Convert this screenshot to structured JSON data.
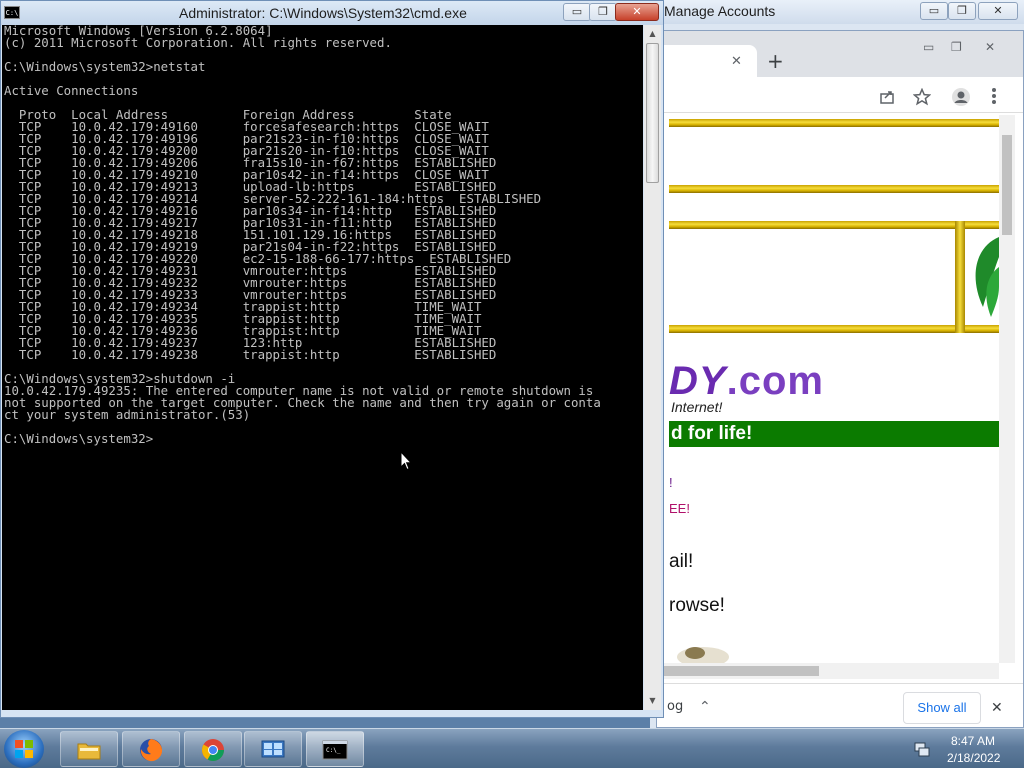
{
  "background_window": {
    "title": "Manage Accounts",
    "minimize": "▭",
    "maximize": "❐",
    "close": "✕"
  },
  "chrome": {
    "tab_close": "✕",
    "new_tab": "+",
    "minimize": "▭",
    "maximize": "❐",
    "close": "✕",
    "page": {
      "logo_main": "DY",
      "logo_dotcom": ".com",
      "tagline": "Internet!",
      "banner": "d for life!",
      "link1": "!",
      "link2": "EE!",
      "line1": "ail!",
      "line2": "rowse!"
    },
    "download_bar": {
      "item": "og",
      "chevron": "⌃",
      "show_all": "Show all",
      "close": "✕"
    }
  },
  "cmd": {
    "title": "Administrator: C:\\Windows\\System32\\cmd.exe",
    "icon_label": "C:\\",
    "minimize": "▭",
    "maximize": "❐",
    "close": "✕",
    "lines": [
      "Microsoft Windows [Version 6.2.8064]",
      "(c) 2011 Microsoft Corporation. All rights reserved.",
      "",
      "C:\\Windows\\system32>netstat",
      "",
      "Active Connections",
      "",
      "  Proto  Local Address          Foreign Address        State",
      "  TCP    10.0.42.179:49160      forcesafesearch:https  CLOSE_WAIT",
      "  TCP    10.0.42.179:49196      par21s23-in-f10:https  CLOSE_WAIT",
      "  TCP    10.0.42.179:49200      par21s20-in-f10:https  CLOSE_WAIT",
      "  TCP    10.0.42.179:49206      fra15s10-in-f67:https  ESTABLISHED",
      "  TCP    10.0.42.179:49210      par10s42-in-f14:https  CLOSE_WAIT",
      "  TCP    10.0.42.179:49213      upload-lb:https        ESTABLISHED",
      "  TCP    10.0.42.179:49214      server-52-222-161-184:https  ESTABLISHED",
      "  TCP    10.0.42.179:49216      par10s34-in-f14:http   ESTABLISHED",
      "  TCP    10.0.42.179:49217      par10s31-in-f11:http   ESTABLISHED",
      "  TCP    10.0.42.179:49218      151.101.129.16:https   ESTABLISHED",
      "  TCP    10.0.42.179:49219      par21s04-in-f22:https  ESTABLISHED",
      "  TCP    10.0.42.179:49220      ec2-15-188-66-177:https  ESTABLISHED",
      "  TCP    10.0.42.179:49231      vmrouter:https         ESTABLISHED",
      "  TCP    10.0.42.179:49232      vmrouter:https         ESTABLISHED",
      "  TCP    10.0.42.179:49233      vmrouter:https         ESTABLISHED",
      "  TCP    10.0.42.179:49234      trappist:http          TIME_WAIT",
      "  TCP    10.0.42.179:49235      trappist:http          TIME_WAIT",
      "  TCP    10.0.42.179:49236      trappist:http          TIME_WAIT",
      "  TCP    10.0.42.179:49237      123:http               ESTABLISHED",
      "  TCP    10.0.42.179:49238      trappist:http          ESTABLISHED",
      "",
      "C:\\Windows\\system32>shutdown -i",
      "10.0.42.179.49235: The entered computer name is not valid or remote shutdown is",
      "not supported on the target computer. Check the name and then try again or conta",
      "ct your system administrator.(53)",
      "",
      "C:\\Windows\\system32>"
    ]
  },
  "taskbar": {
    "items": [
      {
        "name": "file-explorer",
        "icon": "folder-icon"
      },
      {
        "name": "firefox",
        "icon": "firefox-icon"
      },
      {
        "name": "chrome",
        "icon": "chrome-icon"
      },
      {
        "name": "control-panel",
        "icon": "control-panel-icon"
      },
      {
        "name": "cmd",
        "icon": "cmd-icon"
      }
    ],
    "clock_time": "8:47 AM",
    "clock_date": "2/18/2022"
  }
}
